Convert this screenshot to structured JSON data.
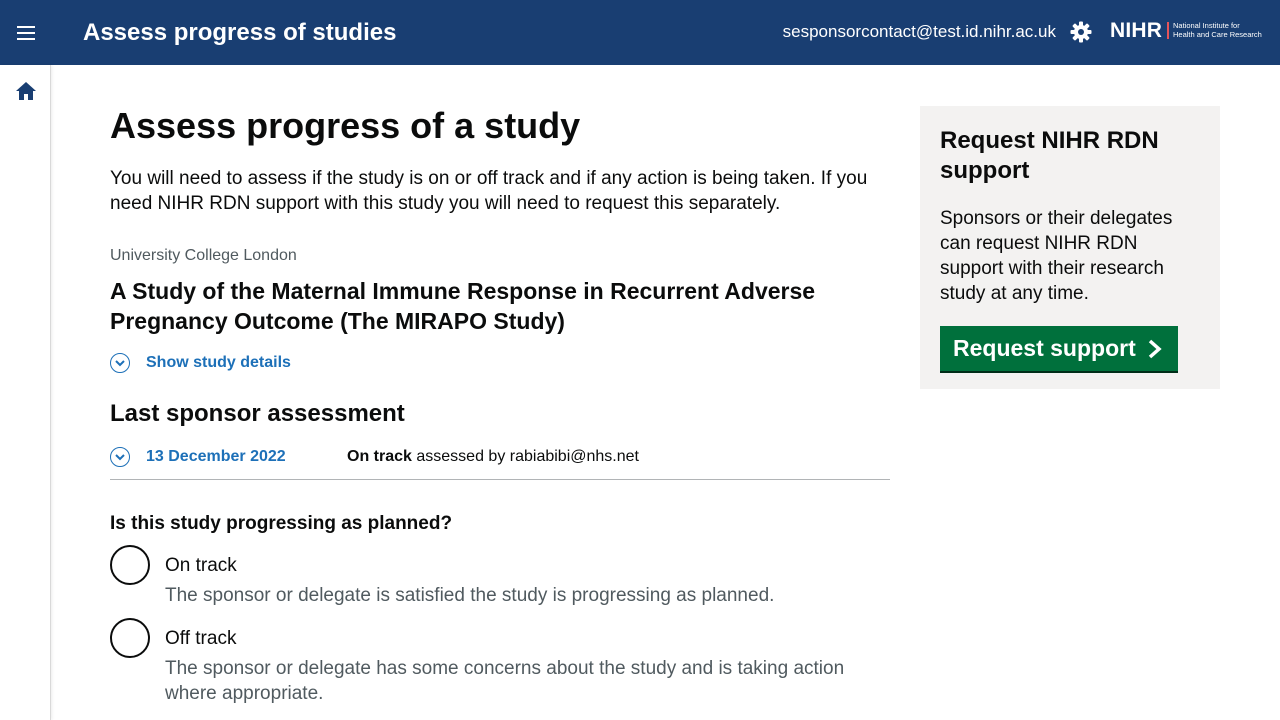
{
  "header": {
    "menu_icon": "hamburger-menu-icon",
    "title": "Assess progress of studies",
    "user_email": "sesponsorcontact@test.id.nihr.ac.uk",
    "settings_icon": "gear-icon",
    "logo": {
      "word": "NIHR",
      "line1": "National Institute for",
      "line2": "Health and Care Research"
    }
  },
  "sidebar": {
    "home_icon": "home-icon"
  },
  "main": {
    "page_title": "Assess progress of a study",
    "intro": "You will need to assess if the study is on or off track and if any action is being taken. If you need NIHR RDN support with this study you will need to request this separately.",
    "organisation": "University College London",
    "study_title": "A Study of the Maternal Immune Response in Recurrent Adverse Pregnancy Outcome (The MIRAPO Study)",
    "show_details_label": "Show study details",
    "last_assessment": {
      "heading": "Last sponsor assessment",
      "date": "13 December 2022",
      "status": "On track",
      "assessed_by_text": "assessed by rabiabibi@nhs.net"
    },
    "question": "Is this study progressing as planned?",
    "options": [
      {
        "label": "On track",
        "hint": "The sponsor or delegate is satisfied the study is progressing as planned."
      },
      {
        "label": "Off track",
        "hint": "The sponsor or delegate has some concerns about the study and is taking action where appropriate."
      }
    ]
  },
  "aside": {
    "title": "Request NIHR RDN support",
    "text": "Sponsors or their delegates can request NIHR RDN support with their research study at any time.",
    "button_label": "Request support"
  },
  "colors": {
    "header_bg": "#193e72",
    "link": "#1d70b8",
    "button_green": "#00703c",
    "panel_bg": "#f3f2f1",
    "hint_grey": "#505a5f"
  }
}
